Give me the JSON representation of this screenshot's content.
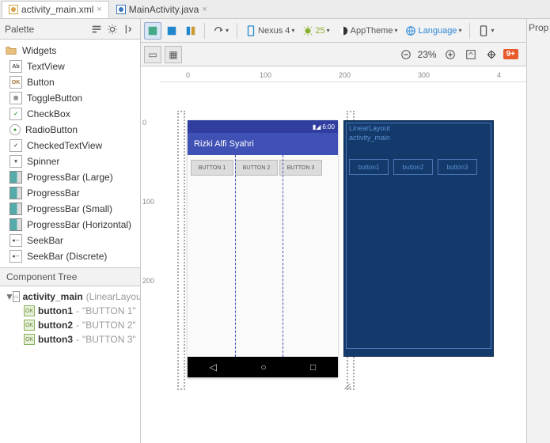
{
  "tabs": [
    {
      "label": "activity_main.xml",
      "active": true
    },
    {
      "label": "MainActivity.java",
      "active": false
    }
  ],
  "palette": {
    "title": "Palette",
    "group": "Widgets",
    "items": [
      "TextView",
      "Button",
      "ToggleButton",
      "CheckBox",
      "RadioButton",
      "CheckedTextView",
      "Spinner",
      "ProgressBar (Large)",
      "ProgressBar",
      "ProgressBar (Small)",
      "ProgressBar (Horizontal)",
      "SeekBar",
      "SeekBar (Discrete)"
    ]
  },
  "component_tree": {
    "title": "Component Tree",
    "root": {
      "name": "activity_main",
      "type": "(LinearLayout)"
    },
    "children": [
      {
        "name": "button1",
        "text": "\"BUTTON 1\""
      },
      {
        "name": "button2",
        "text": "\"BUTTON 2\""
      },
      {
        "name": "button3",
        "text": "\"BUTTON 3\""
      }
    ]
  },
  "toolbar": {
    "device": "Nexus 4",
    "api": "25",
    "theme": "AppTheme",
    "language": "Language"
  },
  "zoom": {
    "value": "23%",
    "warn_count": "9+"
  },
  "ruler_h": [
    "0",
    "100",
    "200",
    "300",
    "4"
  ],
  "ruler_v": [
    "0",
    "100",
    "200"
  ],
  "preview": {
    "status_time": "6:00",
    "app_title": "Rizki Alfi Syahri",
    "buttons": [
      "BUTTON 1",
      "BUTTON 2",
      "BUTTON 3"
    ]
  },
  "blueprint": {
    "root": "LinearLayout",
    "id": "activity_main",
    "buttons": [
      "button1",
      "button2",
      "button3"
    ]
  },
  "props_label": "Prop"
}
